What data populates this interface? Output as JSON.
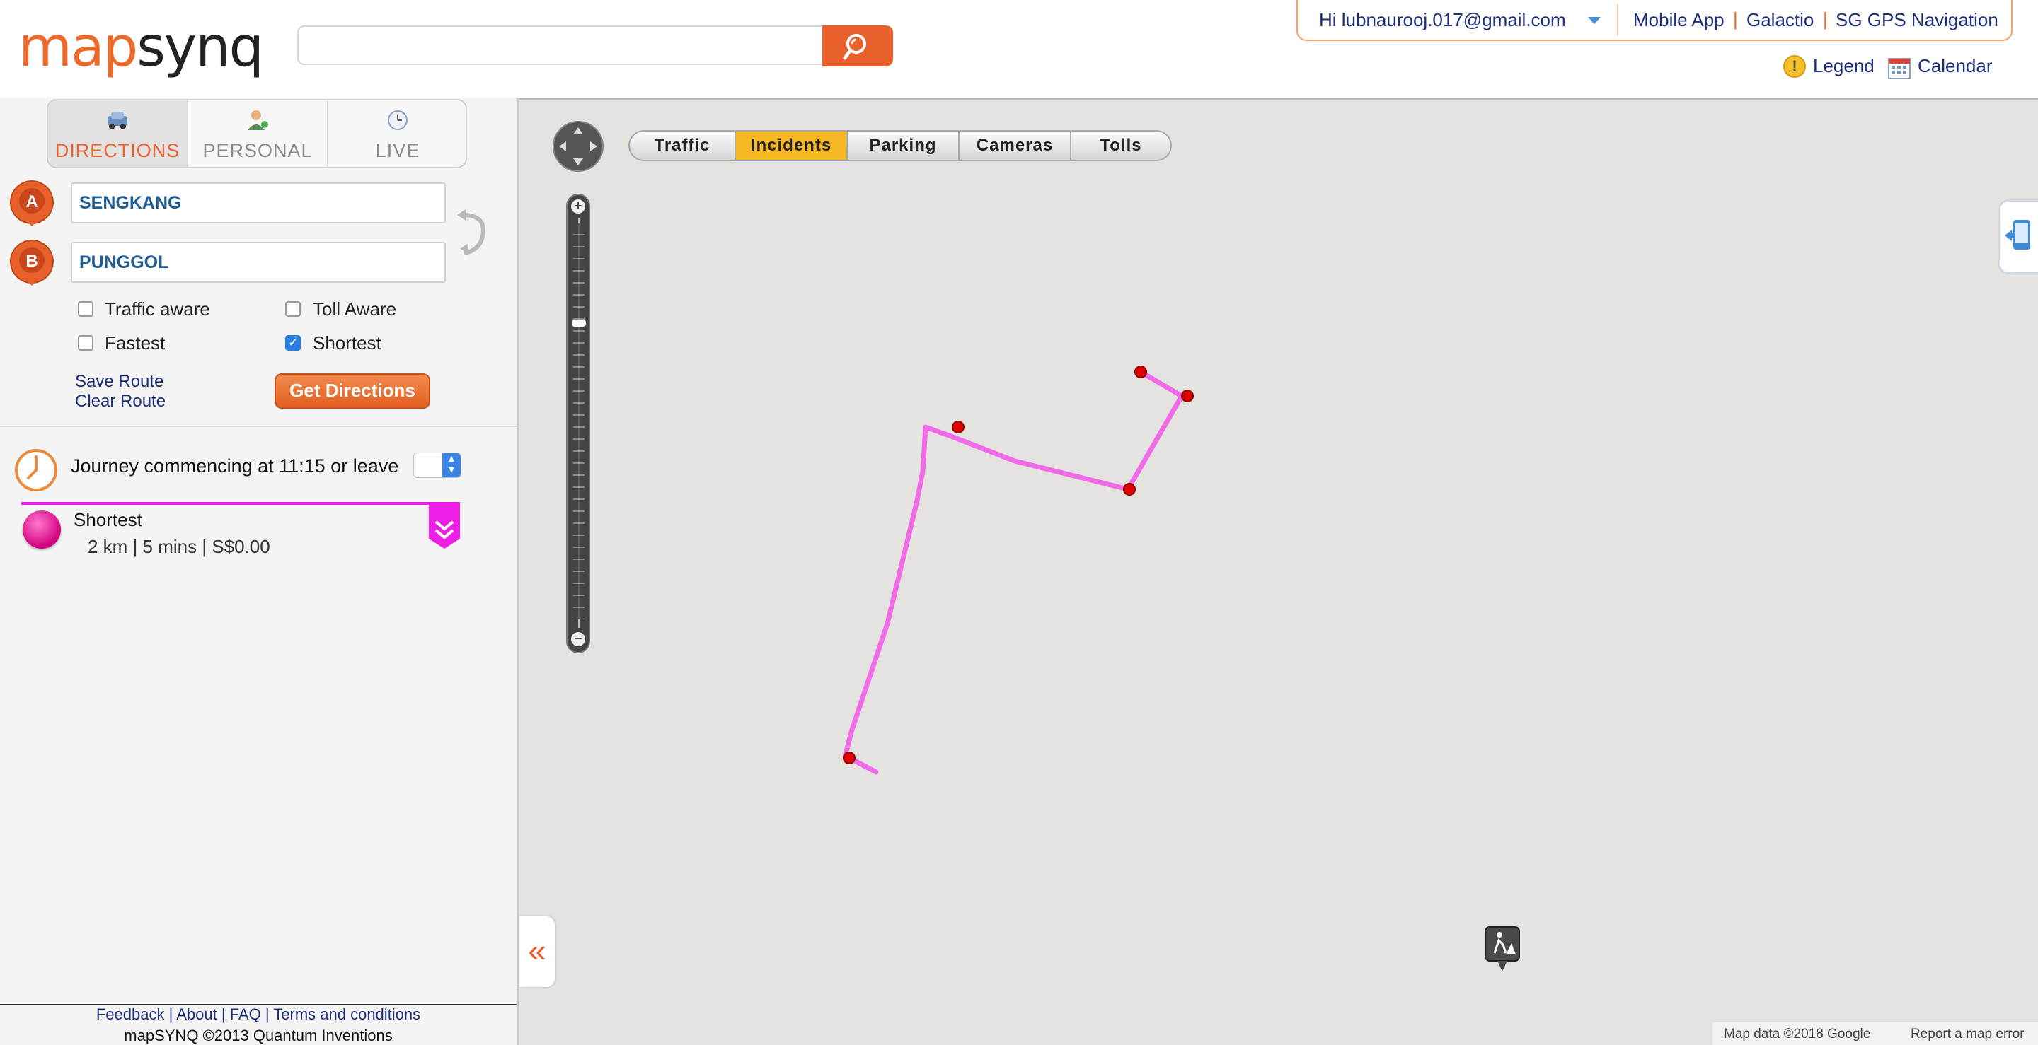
{
  "header": {
    "logo_part1": "map",
    "logo_part2": "synq",
    "search_placeholder": "",
    "user_greeting": "Hi lubnaurooj.017@gmail.com",
    "links": [
      "Mobile App",
      "Galactio",
      "SG GPS Navigation"
    ],
    "separator": "|",
    "legend_label": "Legend",
    "legend_icon_glyph": "!",
    "calendar_label": "Calendar"
  },
  "tabs": [
    {
      "label": "DIRECTIONS",
      "icon": "car-icon",
      "active": true
    },
    {
      "label": "PERSONAL",
      "icon": "person-icon",
      "active": false
    },
    {
      "label": "LIVE",
      "icon": "clock-small-icon",
      "active": false
    }
  ],
  "route_form": {
    "origin_marker": "A",
    "destination_marker": "B",
    "origin_value": "SENGKANG",
    "destination_value": "PUNGGOL",
    "options": [
      {
        "label": "Traffic aware",
        "checked": false
      },
      {
        "label": "Toll Aware",
        "checked": false
      },
      {
        "label": "Fastest",
        "checked": false
      },
      {
        "label": "Shortest",
        "checked": true
      }
    ],
    "save_route": "Save Route",
    "clear_route": "Clear Route",
    "get_directions": "Get Directions"
  },
  "journey": {
    "text": "Journey commencing at 11:15 or leave",
    "leave_value": ""
  },
  "route_result": {
    "name": "Shortest",
    "summary": "2 km | 5 mins | S$0.00",
    "color": "#ee1fe4"
  },
  "footer": {
    "links": [
      "Feedback",
      "About",
      "FAQ",
      "Terms and conditions"
    ],
    "separator": "|",
    "copyright": "mapSYNQ ©2013 Quantum Inventions"
  },
  "map": {
    "layers": [
      {
        "label": "Traffic",
        "active": false
      },
      {
        "label": "Incidents",
        "active": true
      },
      {
        "label": "Parking",
        "active": false
      },
      {
        "label": "Cameras",
        "active": false
      },
      {
        "label": "Tolls",
        "active": false
      }
    ],
    "zoom_in": "+",
    "zoom_out": "−",
    "collapse_glyph": "«",
    "attribution": "Map data ©2018 Google",
    "report_error": "Report a map error",
    "background_color": "#e5e3df",
    "route_color": "#f06be8",
    "waypoint_color": "#e00000"
  },
  "colors": {
    "accent": "#e8612c",
    "link": "#1d2f7a",
    "active_layer": "#f6b824"
  }
}
